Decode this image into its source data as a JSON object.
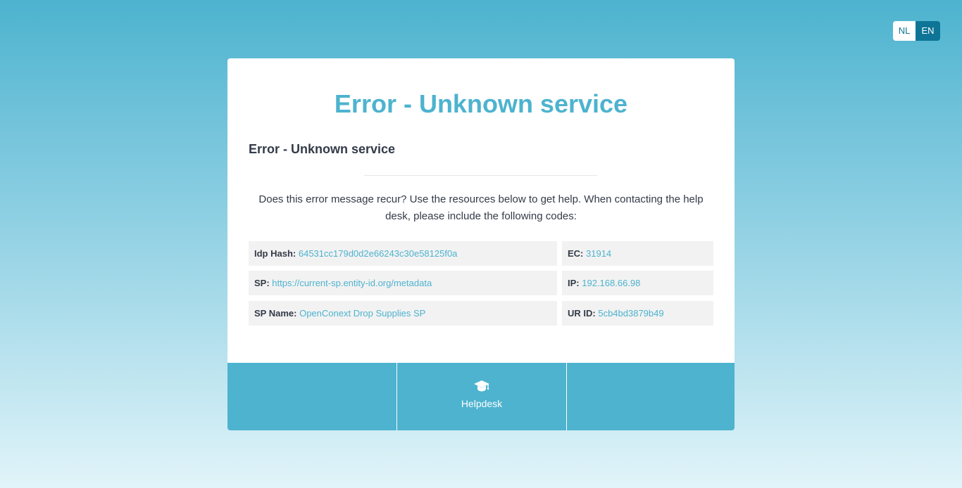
{
  "language": {
    "nl_label": "NL",
    "en_label": "EN",
    "active": "EN"
  },
  "card": {
    "title": "Error - Unknown service",
    "subtitle": "Error - Unknown service",
    "help_text": "Does this error message recur? Use the resources below to get help. When contacting the help desk, please include the following codes:"
  },
  "codes": {
    "idp_hash": {
      "label": "Idp Hash:",
      "value": "64531cc179d0d2e66243c30e58125f0a"
    },
    "ec": {
      "label": "EC:",
      "value": "31914"
    },
    "sp": {
      "label": "SP:",
      "value": "https://current-sp.entity-id.org/metadata"
    },
    "ip": {
      "label": "IP:",
      "value": "192.168.66.98"
    },
    "sp_name": {
      "label": "SP Name:",
      "value": "OpenConext Drop Supplies SP"
    },
    "ur_id": {
      "label": "UR ID:",
      "value": "5cb4bd3879b49"
    }
  },
  "footer": {
    "helpdesk_label": "Helpdesk",
    "helpdesk_icon": "graduation-cap-icon"
  },
  "colors": {
    "accent": "#4db3cf",
    "lang_active": "#0e7596",
    "text": "#333b48",
    "code_bg": "#f2f2f2"
  }
}
